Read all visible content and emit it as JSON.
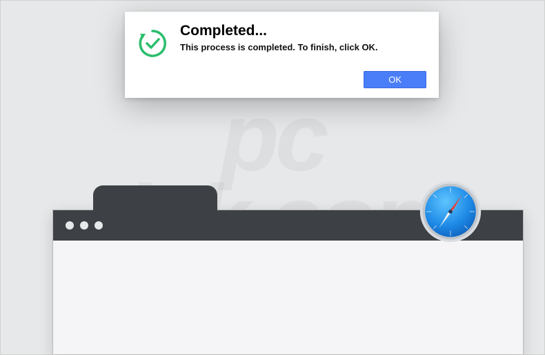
{
  "dialog": {
    "title": "Completed...",
    "message": "This process is completed. To finish, click OK.",
    "ok_label": "OK"
  },
  "watermark": {
    "line1": "pc",
    "line2": "risk.com"
  },
  "icons": {
    "dialog_icon": "checkmark-refresh-icon",
    "safari_icon": "safari-compass-icon"
  },
  "colors": {
    "accent": "#4a7ef8",
    "success": "#2bbd6c",
    "titlebar": "#3d4145",
    "background": "#e6e8ea"
  }
}
